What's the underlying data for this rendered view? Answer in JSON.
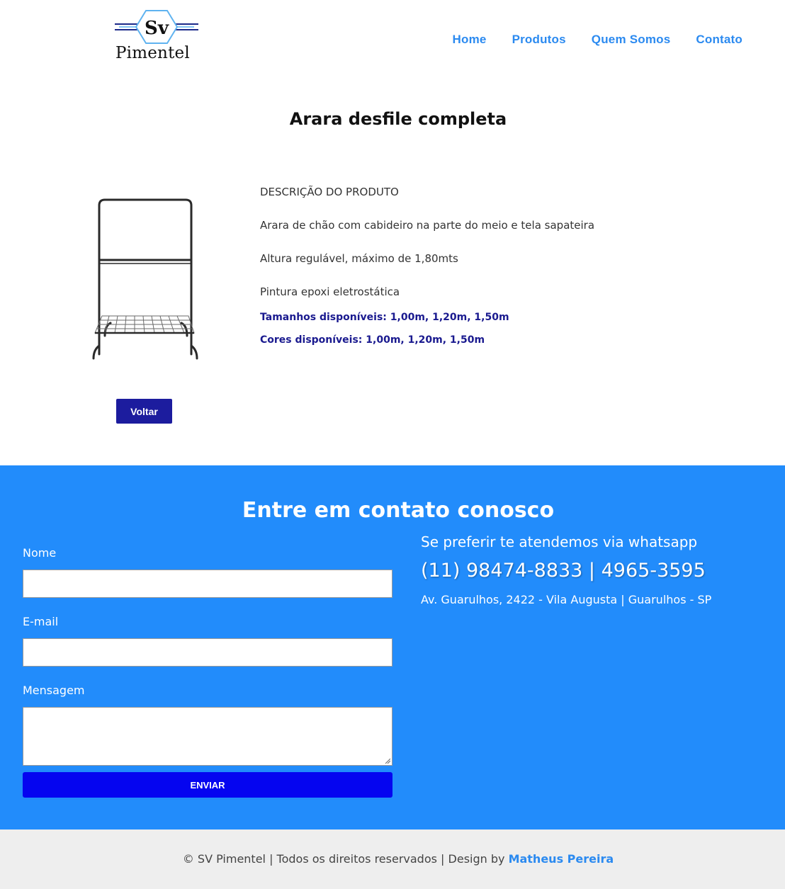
{
  "brand": {
    "logo_mark": "Sv",
    "logo_word": "Pimentel",
    "colors": {
      "primary_blue": "#228cfb",
      "nav_blue": "#2b8af0",
      "dark_blue": "#1c1c9e",
      "send_blue": "#0505f0"
    }
  },
  "nav": {
    "items": [
      {
        "label": "Home"
      },
      {
        "label": "Produtos"
      },
      {
        "label": "Quem Somos"
      },
      {
        "label": "Contato"
      }
    ]
  },
  "product": {
    "title": "Arara desfile completa",
    "image_icon": "clothing-rack-image",
    "description_heading": "DESCRIÇÃO DO PRODUTO",
    "description_lines": [
      "Arara de chão com cabideiro na parte do meio e tela sapateira",
      "Altura regulável, máximo de 1,80mts",
      "Pintura epoxi eletrostática"
    ],
    "sizes": "Tamanhos disponíveis: 1,00m, 1,20m, 1,50m",
    "colors": "Cores disponíveis: 1,00m, 1,20m, 1,50m",
    "back_label": "Voltar"
  },
  "contact": {
    "title": "Entre em contato conosco",
    "form": {
      "name_label": "Nome",
      "name_value": "",
      "email_label": "E-mail",
      "email_value": "",
      "message_label": "Mensagem",
      "message_value": "",
      "submit_label": "ENVIAR"
    },
    "whatsapp_text": "Se preferir te atendemos via whatsapp",
    "phone": "(11) 98474-8833 | 4965-3595",
    "address": "Av. Guarulhos, 2422 - Vila Augusta | Guarulhos - SP"
  },
  "footer": {
    "text": "© SV Pimentel | Todos os direitos reservados | Design by ",
    "author": "Matheus Pereira"
  }
}
